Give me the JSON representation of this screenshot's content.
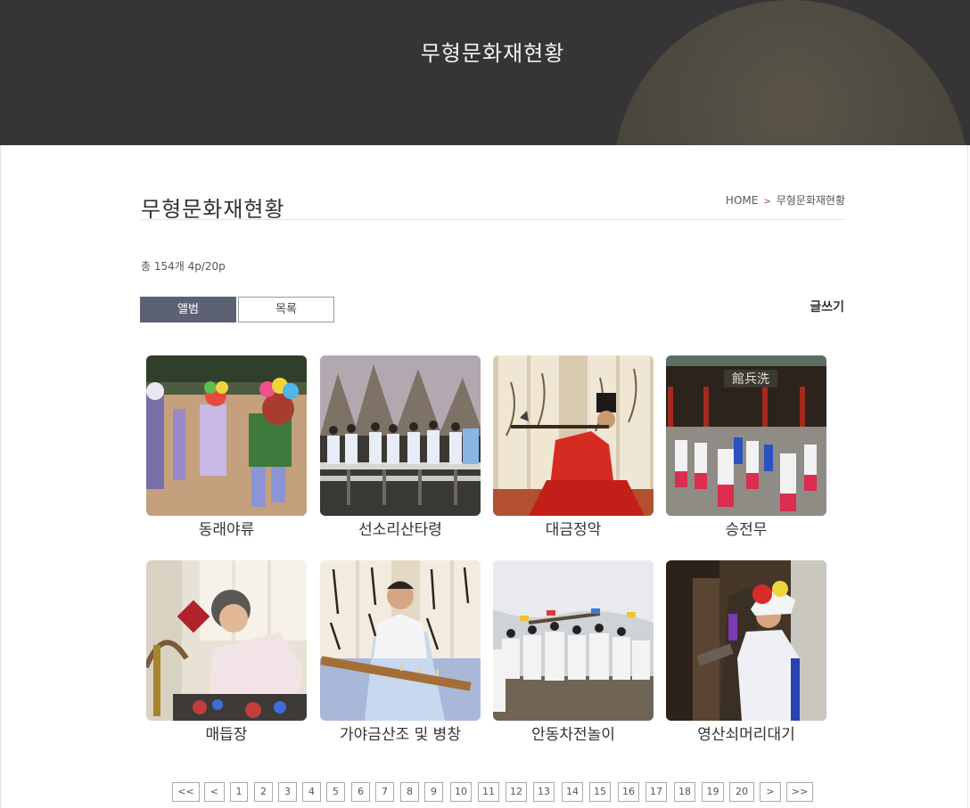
{
  "hero": {
    "title": "무형문화재현황"
  },
  "header": {
    "title": "무형문화재현황",
    "breadcrumb": {
      "home": "HOME",
      "separator": ">",
      "current": "무형문화재현황"
    }
  },
  "summary": {
    "text": "총 154개 4p/20p"
  },
  "view_toggle": {
    "album": "앨범",
    "list": "목록",
    "active": "album"
  },
  "write_button": "글쓰기",
  "colors": {
    "hero_bg": "#353535",
    "active_toggle": "#5c6274",
    "accent_sep": "#c0392b"
  },
  "gallery": [
    {
      "caption": "동래야류",
      "icon": "mask-dance-photo"
    },
    {
      "caption": "선소리산타령",
      "icon": "folk-song-photo"
    },
    {
      "caption": "대금정악",
      "icon": "flute-player-photo"
    },
    {
      "caption": "승전무",
      "icon": "court-dance-photo"
    },
    {
      "caption": "매듭장",
      "icon": "knot-craft-photo"
    },
    {
      "caption": "가야금산조 및 병창",
      "icon": "gayageum-player-photo"
    },
    {
      "caption": "안동차전놀이",
      "icon": "chariot-battle-photo"
    },
    {
      "caption": "영산쇠머리대기",
      "icon": "bull-head-game-photo"
    }
  ],
  "pagination": {
    "first": "<<",
    "prev": "<",
    "next": ">",
    "last": ">>",
    "pages": [
      "1",
      "2",
      "3",
      "4",
      "5",
      "6",
      "7",
      "8",
      "9",
      "10",
      "11",
      "12",
      "13",
      "14",
      "15",
      "16",
      "17",
      "18",
      "19",
      "20"
    ]
  }
}
